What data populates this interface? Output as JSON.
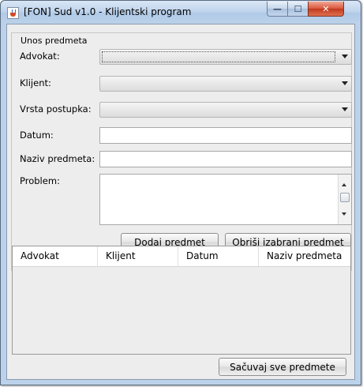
{
  "window": {
    "title": "[FON] Sud v1.0 - Klijentski program",
    "caption_buttons": {
      "minimize": "—",
      "maximize": "☐",
      "close": "✕"
    }
  },
  "form": {
    "group_title": "Unos predmeta",
    "fields": {
      "advokat": {
        "label": "Advokat:",
        "value": ""
      },
      "klijent": {
        "label": "Klijent:",
        "value": ""
      },
      "vrsta_postupka": {
        "label": "Vrsta postupka:",
        "value": ""
      },
      "datum": {
        "label": "Datum:",
        "value": ""
      },
      "naziv_predmeta": {
        "label": "Naziv predmeta:",
        "value": ""
      },
      "problem": {
        "label": "Problem:",
        "value": ""
      }
    },
    "buttons": {
      "add": "Dodaj predmet",
      "delete_selected": "Obriši izabrani predmet"
    }
  },
  "table": {
    "columns": [
      "Advokat",
      "Klijent",
      "Datum",
      "Naziv predmeta"
    ],
    "rows": []
  },
  "footer": {
    "save_all": "Sačuvaj sve predmete"
  }
}
